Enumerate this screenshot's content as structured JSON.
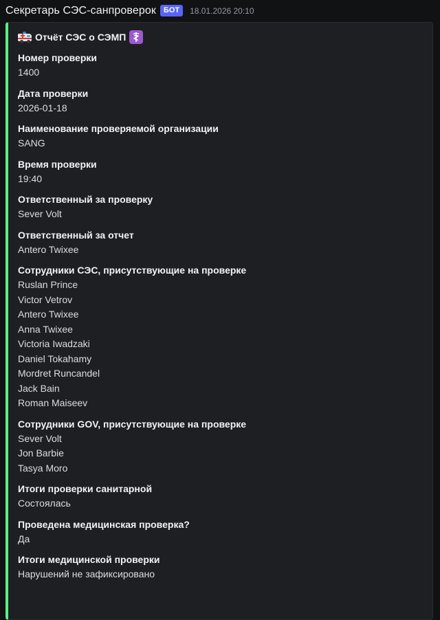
{
  "message": {
    "author": "Секретарь СЭС-санпроверок",
    "bot_tag": "БОТ",
    "timestamp": "18.01.2026 20:10"
  },
  "embed": {
    "accent_color": "#57f287",
    "title_text": "Отчёт СЭС о СЭМП",
    "title_icons": [
      "ambulance-emoji",
      "medical-symbol-emoji"
    ],
    "fields": [
      {
        "name": "Номер проверки",
        "values": [
          "1400"
        ]
      },
      {
        "name": "Дата проверки",
        "values": [
          "2026-01-18"
        ]
      },
      {
        "name": "Наименование проверяемой организации",
        "values": [
          "SANG"
        ]
      },
      {
        "name": "Время проверки",
        "values": [
          "19:40"
        ]
      },
      {
        "name": "Ответственный за проверку",
        "values": [
          "Sever Volt"
        ]
      },
      {
        "name": "Ответственный за отчет",
        "values": [
          "Antero Twixee"
        ]
      },
      {
        "name": "Сотрудники СЭС, присутствующие на проверке",
        "values": [
          "Ruslan Prince",
          "Victor Vetrov",
          "Antero Twixee",
          "Anna Twixee",
          "Victoria Iwadzaki",
          "Daniel Tokahamy",
          "Mordret Runcandel",
          "Jack Bain",
          "Roman Maiseev"
        ]
      },
      {
        "name": "Сотрудники GOV, присутствующие на проверке",
        "values": [
          "Sever Volt",
          "Jon Barbie",
          "Tasya Moro"
        ]
      },
      {
        "name": "Итоги проверки санитарной",
        "values": [
          "Состоялась"
        ]
      },
      {
        "name": "Проведена медицинская проверка?",
        "values": [
          "Да"
        ]
      },
      {
        "name": "Итоги медицинской проверки",
        "values": [
          "Нарушений не зафиксировано"
        ]
      }
    ]
  }
}
